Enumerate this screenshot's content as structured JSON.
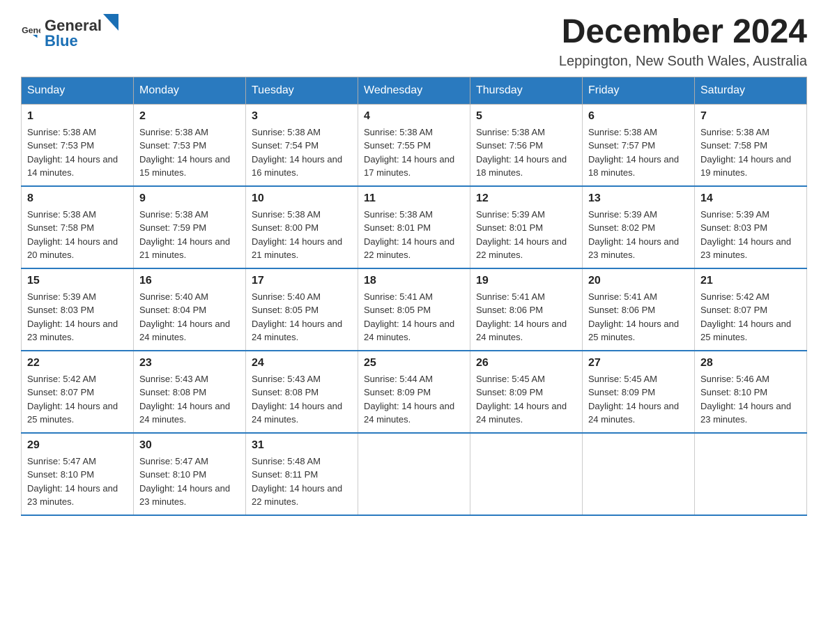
{
  "header": {
    "logo_text_general": "General",
    "logo_text_blue": "Blue",
    "month_title": "December 2024",
    "location": "Leppington, New South Wales, Australia"
  },
  "weekdays": [
    "Sunday",
    "Monday",
    "Tuesday",
    "Wednesday",
    "Thursday",
    "Friday",
    "Saturday"
  ],
  "weeks": [
    [
      {
        "day": "1",
        "sunrise": "5:38 AM",
        "sunset": "7:53 PM",
        "daylight": "14 hours and 14 minutes."
      },
      {
        "day": "2",
        "sunrise": "5:38 AM",
        "sunset": "7:53 PM",
        "daylight": "14 hours and 15 minutes."
      },
      {
        "day": "3",
        "sunrise": "5:38 AM",
        "sunset": "7:54 PM",
        "daylight": "14 hours and 16 minutes."
      },
      {
        "day": "4",
        "sunrise": "5:38 AM",
        "sunset": "7:55 PM",
        "daylight": "14 hours and 17 minutes."
      },
      {
        "day": "5",
        "sunrise": "5:38 AM",
        "sunset": "7:56 PM",
        "daylight": "14 hours and 18 minutes."
      },
      {
        "day": "6",
        "sunrise": "5:38 AM",
        "sunset": "7:57 PM",
        "daylight": "14 hours and 18 minutes."
      },
      {
        "day": "7",
        "sunrise": "5:38 AM",
        "sunset": "7:58 PM",
        "daylight": "14 hours and 19 minutes."
      }
    ],
    [
      {
        "day": "8",
        "sunrise": "5:38 AM",
        "sunset": "7:58 PM",
        "daylight": "14 hours and 20 minutes."
      },
      {
        "day": "9",
        "sunrise": "5:38 AM",
        "sunset": "7:59 PM",
        "daylight": "14 hours and 21 minutes."
      },
      {
        "day": "10",
        "sunrise": "5:38 AM",
        "sunset": "8:00 PM",
        "daylight": "14 hours and 21 minutes."
      },
      {
        "day": "11",
        "sunrise": "5:38 AM",
        "sunset": "8:01 PM",
        "daylight": "14 hours and 22 minutes."
      },
      {
        "day": "12",
        "sunrise": "5:39 AM",
        "sunset": "8:01 PM",
        "daylight": "14 hours and 22 minutes."
      },
      {
        "day": "13",
        "sunrise": "5:39 AM",
        "sunset": "8:02 PM",
        "daylight": "14 hours and 23 minutes."
      },
      {
        "day": "14",
        "sunrise": "5:39 AM",
        "sunset": "8:03 PM",
        "daylight": "14 hours and 23 minutes."
      }
    ],
    [
      {
        "day": "15",
        "sunrise": "5:39 AM",
        "sunset": "8:03 PM",
        "daylight": "14 hours and 23 minutes."
      },
      {
        "day": "16",
        "sunrise": "5:40 AM",
        "sunset": "8:04 PM",
        "daylight": "14 hours and 24 minutes."
      },
      {
        "day": "17",
        "sunrise": "5:40 AM",
        "sunset": "8:05 PM",
        "daylight": "14 hours and 24 minutes."
      },
      {
        "day": "18",
        "sunrise": "5:41 AM",
        "sunset": "8:05 PM",
        "daylight": "14 hours and 24 minutes."
      },
      {
        "day": "19",
        "sunrise": "5:41 AM",
        "sunset": "8:06 PM",
        "daylight": "14 hours and 24 minutes."
      },
      {
        "day": "20",
        "sunrise": "5:41 AM",
        "sunset": "8:06 PM",
        "daylight": "14 hours and 25 minutes."
      },
      {
        "day": "21",
        "sunrise": "5:42 AM",
        "sunset": "8:07 PM",
        "daylight": "14 hours and 25 minutes."
      }
    ],
    [
      {
        "day": "22",
        "sunrise": "5:42 AM",
        "sunset": "8:07 PM",
        "daylight": "14 hours and 25 minutes."
      },
      {
        "day": "23",
        "sunrise": "5:43 AM",
        "sunset": "8:08 PM",
        "daylight": "14 hours and 24 minutes."
      },
      {
        "day": "24",
        "sunrise": "5:43 AM",
        "sunset": "8:08 PM",
        "daylight": "14 hours and 24 minutes."
      },
      {
        "day": "25",
        "sunrise": "5:44 AM",
        "sunset": "8:09 PM",
        "daylight": "14 hours and 24 minutes."
      },
      {
        "day": "26",
        "sunrise": "5:45 AM",
        "sunset": "8:09 PM",
        "daylight": "14 hours and 24 minutes."
      },
      {
        "day": "27",
        "sunrise": "5:45 AM",
        "sunset": "8:09 PM",
        "daylight": "14 hours and 24 minutes."
      },
      {
        "day": "28",
        "sunrise": "5:46 AM",
        "sunset": "8:10 PM",
        "daylight": "14 hours and 23 minutes."
      }
    ],
    [
      {
        "day": "29",
        "sunrise": "5:47 AM",
        "sunset": "8:10 PM",
        "daylight": "14 hours and 23 minutes."
      },
      {
        "day": "30",
        "sunrise": "5:47 AM",
        "sunset": "8:10 PM",
        "daylight": "14 hours and 23 minutes."
      },
      {
        "day": "31",
        "sunrise": "5:48 AM",
        "sunset": "8:11 PM",
        "daylight": "14 hours and 22 minutes."
      },
      null,
      null,
      null,
      null
    ]
  ],
  "labels": {
    "sunrise_prefix": "Sunrise: ",
    "sunset_prefix": "Sunset: ",
    "daylight_prefix": "Daylight: "
  },
  "colors": {
    "header_bg": "#2a7abf",
    "accent_blue": "#1a6fb5"
  }
}
